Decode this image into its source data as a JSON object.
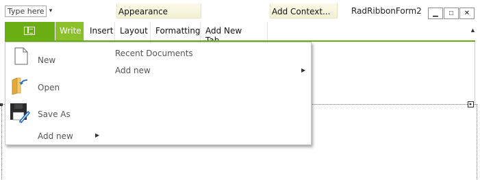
{
  "quick_access": {
    "search_value": "Type here",
    "dropdown_glyph": "▾"
  },
  "contextual_tabs": [
    {
      "label": "Appearance"
    },
    {
      "label": "Add Context..."
    }
  ],
  "window": {
    "title": "RadRibbonForm2",
    "minimize_glyph": "▁",
    "maximize_glyph": "□",
    "close_glyph": "✕"
  },
  "ribbon": {
    "tabs": [
      {
        "label": "Write",
        "selected": true
      },
      {
        "label": "Insert"
      },
      {
        "label": "Layout"
      },
      {
        "label": "Formatting"
      },
      {
        "label": "Add New Tab..."
      }
    ],
    "collapse_glyph": "▲",
    "accent_color": "#6aae13",
    "selected_tab_color": "#8bc02a"
  },
  "app_menu": {
    "items": [
      {
        "label": "New",
        "icon": "new-document-icon"
      },
      {
        "label": "Open",
        "icon": "open-folder-icon"
      },
      {
        "label": "Save As",
        "icon": "save-as-icon"
      },
      {
        "label": "Add new",
        "icon": "submenu-arrow-icon"
      }
    ],
    "submenu_arrow": "▶",
    "recent_header": "Recent Documents",
    "recent_add_new": "Add new"
  },
  "document_handle_glyph": "▸"
}
